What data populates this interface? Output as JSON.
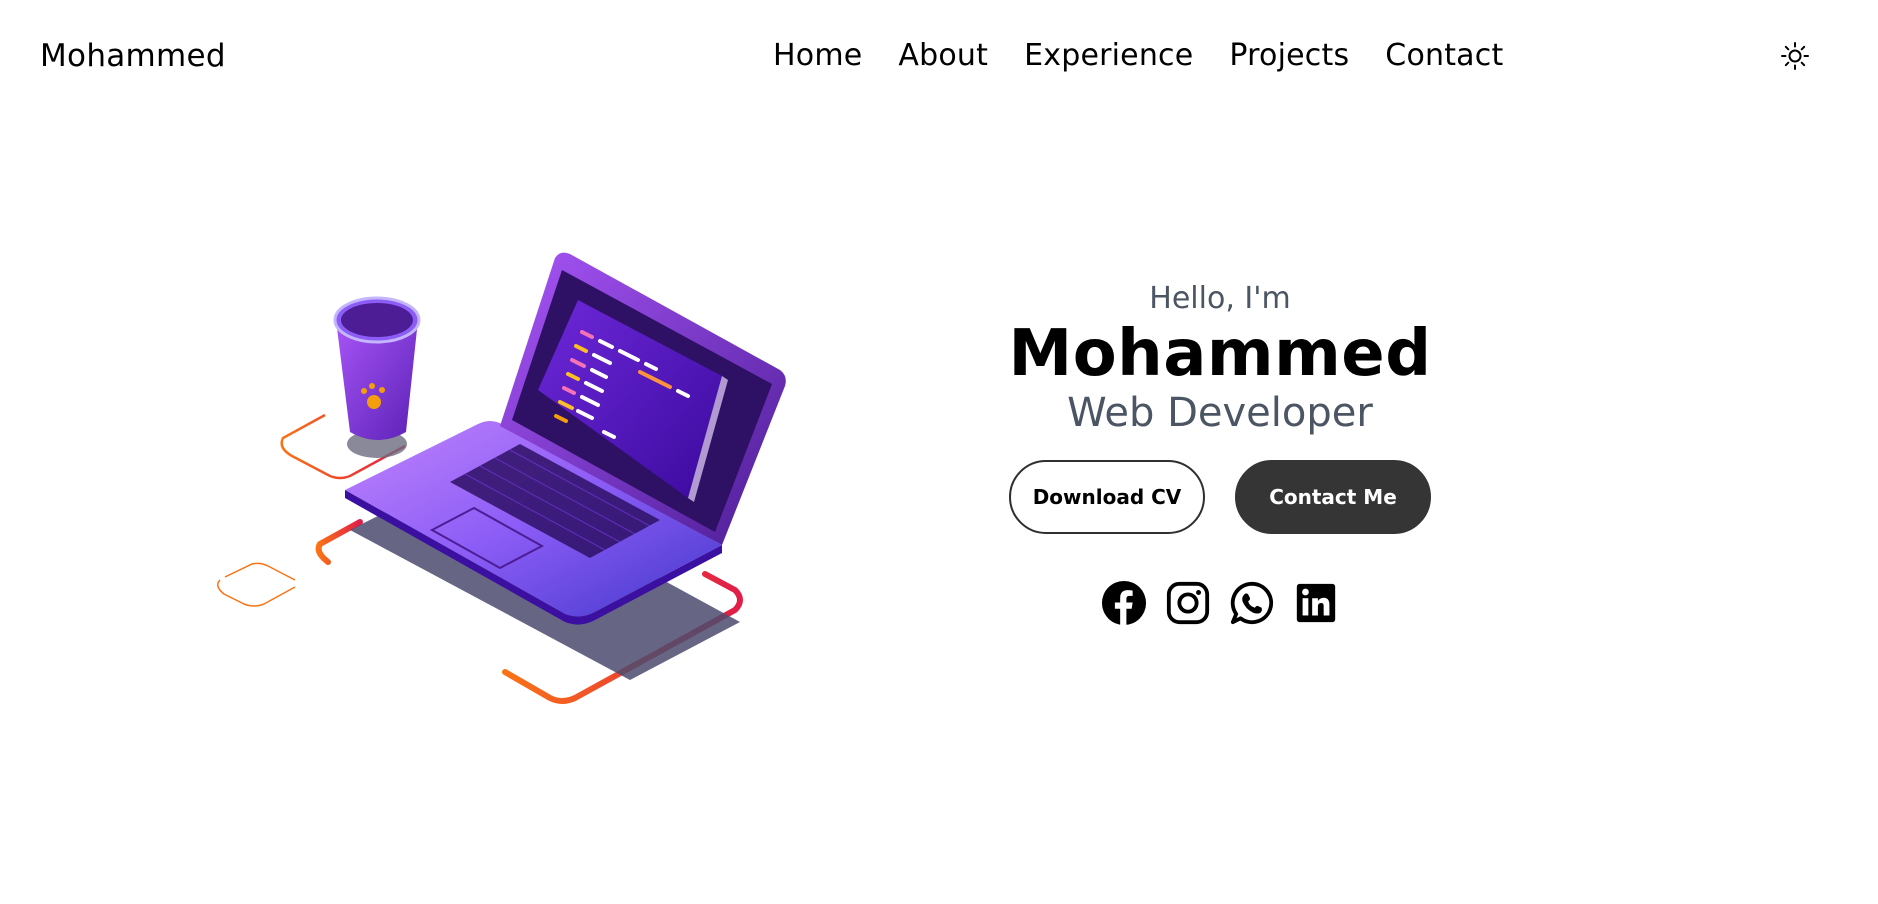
{
  "header": {
    "logo": "Mohammed",
    "nav": [
      {
        "label": "Home"
      },
      {
        "label": "About"
      },
      {
        "label": "Experience"
      },
      {
        "label": "Projects"
      },
      {
        "label": "Contact"
      }
    ],
    "theme_toggle_icon": "sun-icon"
  },
  "hero": {
    "greeting": "Hello, I'm",
    "name": "Mohammed",
    "role": "Web Developer",
    "buttons": {
      "download": "Download CV",
      "contact": "Contact Me"
    },
    "socials": [
      "facebook-icon",
      "instagram-icon",
      "whatsapp-icon",
      "linkedin-icon"
    ],
    "illustration": "laptop-and-cup-illustration"
  },
  "colors": {
    "text": "#000000",
    "muted": "#4b5563",
    "button_dark": "#353535",
    "accent_purple": "#7c3aed",
    "accent_orange": "#f97316"
  }
}
